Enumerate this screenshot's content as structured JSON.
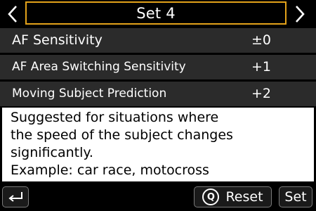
{
  "header": {
    "title": "Set 4",
    "prev_icon": "chevron-left-icon",
    "next_icon": "chevron-right-icon",
    "accent_color": "#e3a21a"
  },
  "settings": [
    {
      "label": "AF Sensitivity",
      "value": "±0"
    },
    {
      "label": "AF Area Switching Sensitivity",
      "value": "+1"
    },
    {
      "label": "Moving Subject Prediction",
      "value": "+2"
    }
  ],
  "description": {
    "lines": [
      "Suggested for situations where",
      "the speed of the subject changes",
      "significantly.",
      "Example: car race, motocross"
    ]
  },
  "footer": {
    "back_icon": "return-arrow-icon",
    "reset_icon_letter": "Q",
    "reset_label": "Reset",
    "set_label": "Set"
  }
}
